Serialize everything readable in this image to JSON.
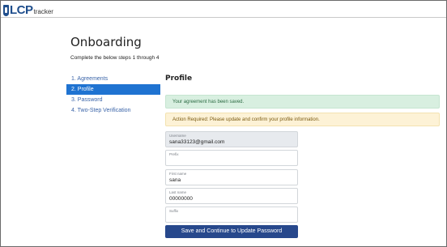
{
  "app": {
    "logo_text": "LCP",
    "logo_subtext": "tracker"
  },
  "page": {
    "title": "Onboarding",
    "subtitle": "Complete the below steps 1 through 4"
  },
  "steps": [
    {
      "label": "1. Agreements",
      "active": false
    },
    {
      "label": "2. Profile",
      "active": true
    },
    {
      "label": "3. Password",
      "active": false
    },
    {
      "label": "4. Two-Step Verification",
      "active": false
    }
  ],
  "profile": {
    "title": "Profile",
    "success_message": "Your agreement has been saved.",
    "warning_message": "Action Required: Please update and confirm your profile information.",
    "fields": {
      "username": {
        "label": "Username",
        "value": "sana33123@gmail.com"
      },
      "prefix": {
        "label": "Prefix",
        "value": ""
      },
      "first_name": {
        "label": "First name",
        "value": "sana"
      },
      "last_name": {
        "label": "Last name",
        "value": "00000000"
      },
      "suffix": {
        "label": "Suffix",
        "value": ""
      }
    },
    "submit_label": "Save and Continue to Update Password"
  },
  "colors": {
    "brand": "#1f4e8c",
    "active_step": "#1f73d1",
    "button": "#27488c",
    "success_bg": "#d8efe0",
    "warning_bg": "#fdf2d6"
  }
}
